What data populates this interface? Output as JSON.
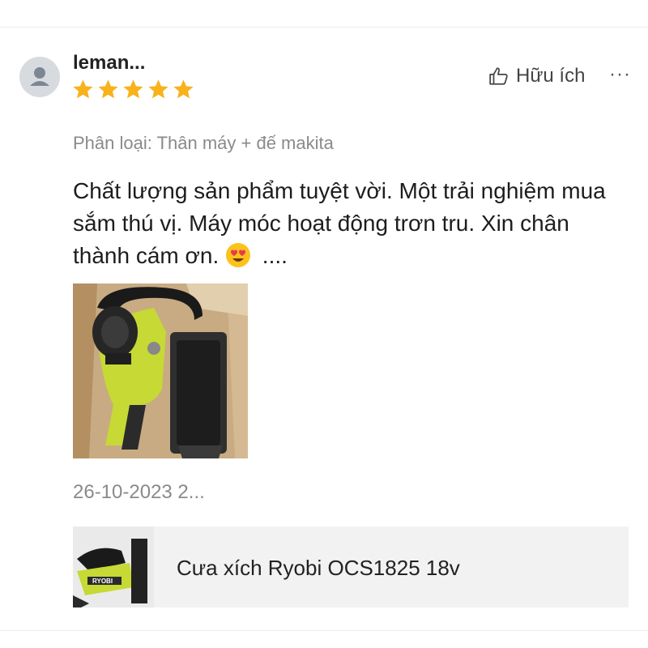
{
  "review": {
    "username": "leman...",
    "rating": 5,
    "rating_max": 5,
    "helpful_label": "Hữu ích",
    "more_label": "···",
    "variant": "Phân loại: Thân máy + đế makita",
    "comment": "Chất lượng sản phẩm tuyệt vời. Một trải nghiệm mua sắm thú vị. Máy móc hoạt động trơn tru. Xin chân thành cám ơn.",
    "comment_tail": "....",
    "date": "26-10-2023 2..."
  },
  "product": {
    "name": "Cưa xích Ryobi OCS1825 18v",
    "thumb_brand": "RYOBI"
  },
  "colors": {
    "star": "#f8b21c",
    "tool_green": "#c6d934",
    "cardboard": "#c8ab82"
  }
}
